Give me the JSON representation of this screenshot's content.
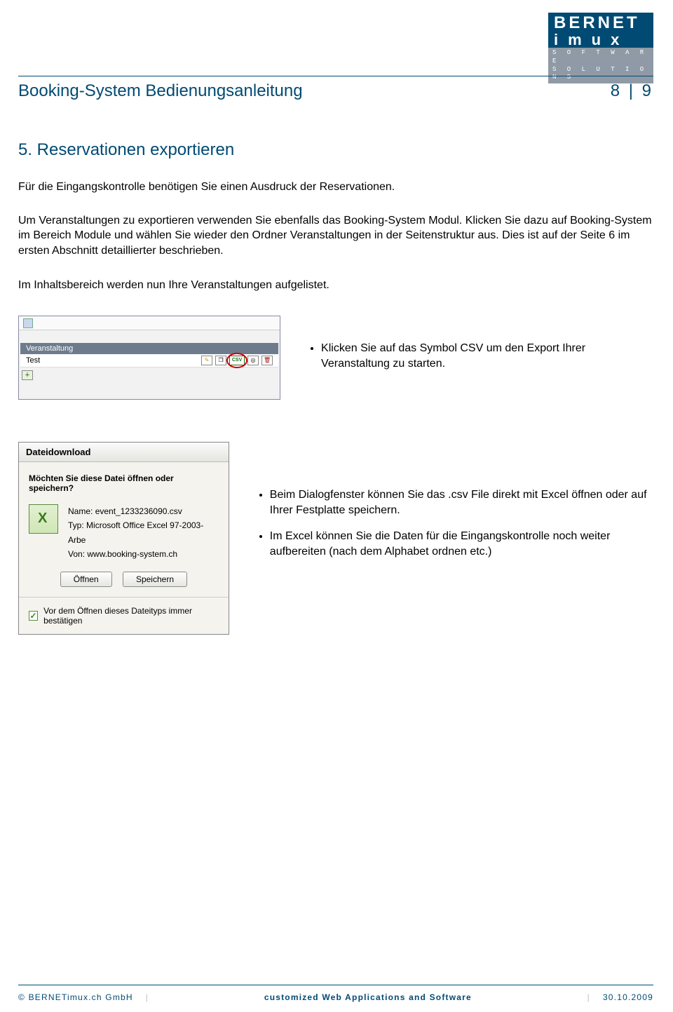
{
  "logo": {
    "line1": "BERNET",
    "line2": "imux",
    "sub1": "S O F T W A R E",
    "sub2": "S O L U T I O N S"
  },
  "header": {
    "title": "Booking-System Bedienungsanleitung",
    "page": "8 | 9"
  },
  "section": {
    "num_title": "5.   Reservationen exportieren"
  },
  "intro": {
    "p1": "Für die Eingangskontrolle benötigen Sie einen Ausdruck der Reservationen.",
    "p2": "Um Veranstaltungen zu exportieren verwenden Sie ebenfalls das Booking-System Modul. Klicken Sie dazu auf Booking-System im Bereich Module und wählen Sie wieder den Ordner Veranstaltungen in der Seitenstruktur aus. Dies ist auf der Seite 6 im ersten Abschnitt detaillierter beschrieben.",
    "p3": "Im Inhaltsbereich werden nun Ihre Veranstaltungen aufgelistet."
  },
  "shot1": {
    "header": "Veranstaltung",
    "event_name": "Test",
    "csv_label": "CSV"
  },
  "bullets1": {
    "b1": "Klicken Sie auf das Symbol CSV um den Export Ihrer Veranstaltung zu starten."
  },
  "dialog": {
    "title": "Dateidownload",
    "question": "Möchten Sie diese Datei öffnen oder speichern?",
    "name_label": "Name:",
    "name_value": "event_1233236090.csv",
    "type_label": "Typ:",
    "type_value": "Microsoft Office Excel 97-2003-Arbe",
    "from_label": "Von:",
    "from_value": "www.booking-system.ch",
    "open": "Öffnen",
    "save": "Speichern",
    "checkbox": "Vor dem Öffnen dieses Dateityps immer bestätigen"
  },
  "bullets2": {
    "b1": "Beim Dialogfenster können Sie das .csv File direkt mit Excel öffnen oder auf Ihrer Festplatte speichern.",
    "b2": "Im Excel können Sie die Daten für die Eingangskontrolle noch weiter aufbereiten (nach dem Alphabet ordnen etc.)"
  },
  "footer": {
    "left": "© BERNETimux.ch GmbH",
    "mid": "customized Web Applications and Software",
    "right": "30.10.2009"
  }
}
